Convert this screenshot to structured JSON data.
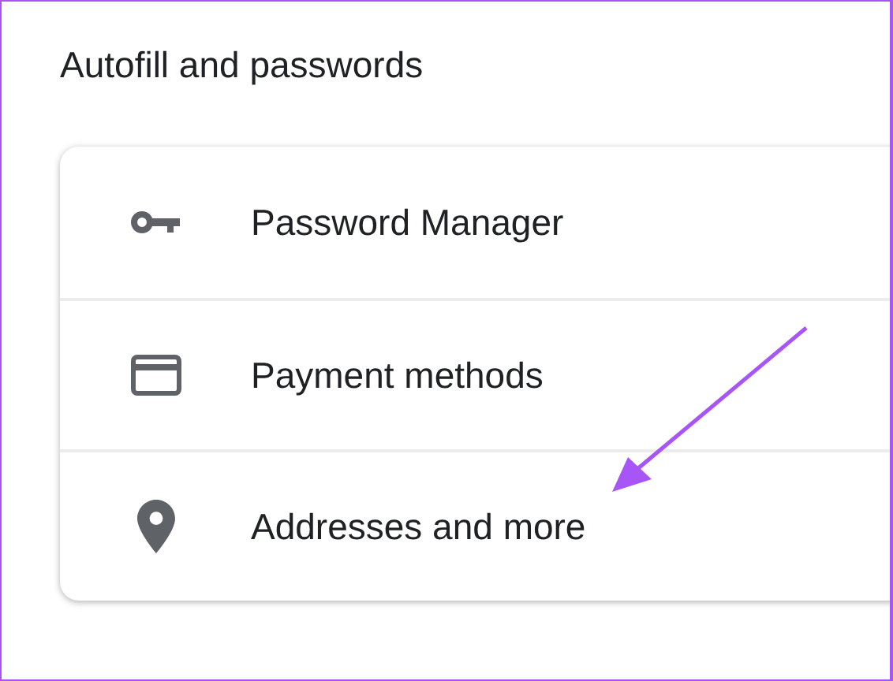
{
  "section": {
    "title": "Autofill and passwords"
  },
  "items": [
    {
      "kind": "key",
      "label": "Password Manager"
    },
    {
      "kind": "card",
      "label": "Payment methods"
    },
    {
      "kind": "pin",
      "label": "Addresses and more"
    }
  ]
}
